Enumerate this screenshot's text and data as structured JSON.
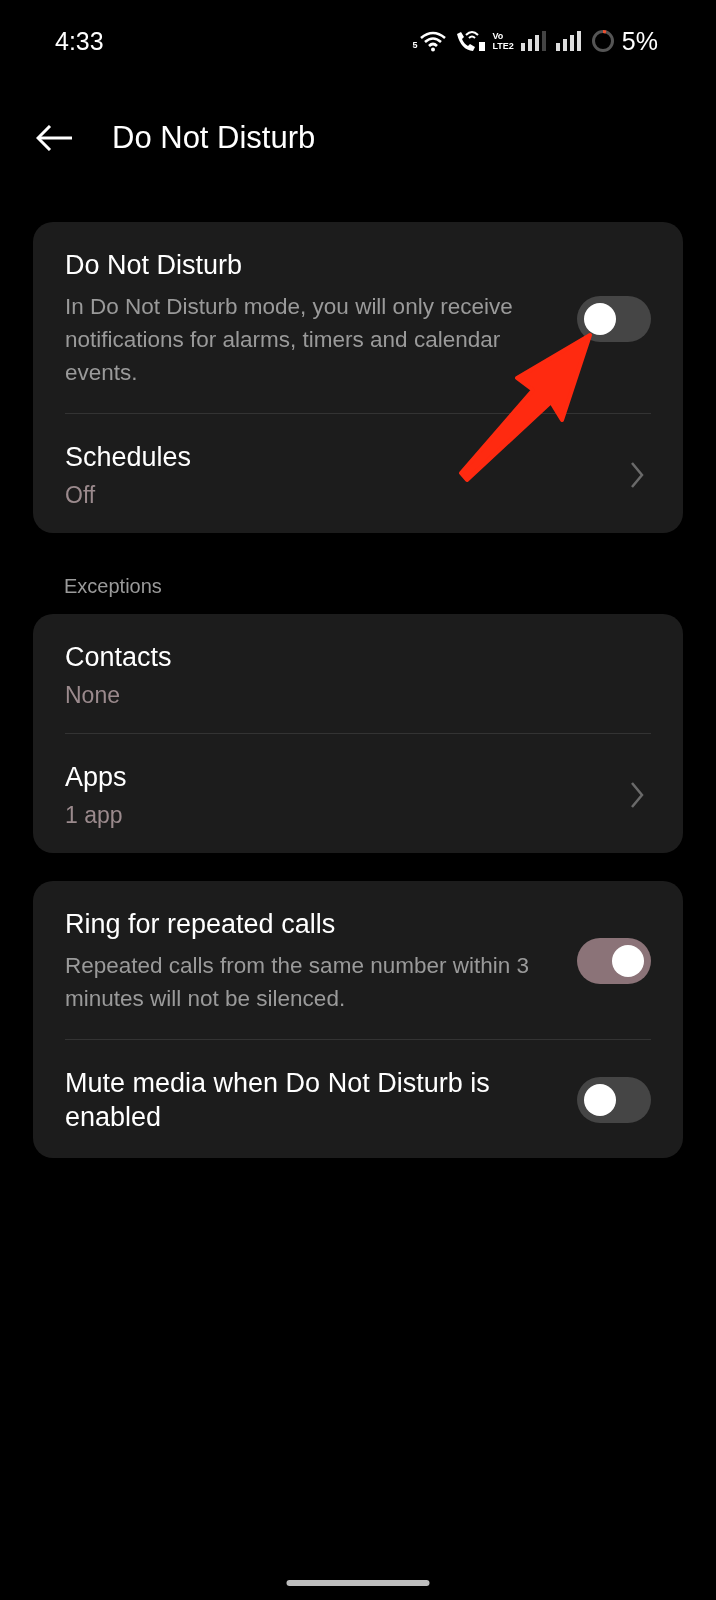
{
  "status_bar": {
    "time": "4:33",
    "wifi_badge": "5",
    "volte_top": "Vo",
    "volte_bottom": "LTE2",
    "battery": "5%"
  },
  "header": {
    "title": "Do Not Disturb"
  },
  "sections": [
    {
      "rows": [
        {
          "kind": "toggle",
          "title": "Do Not Disturb",
          "subtitle": "In Do Not Disturb mode, you will only receive notifications for alarms, timers and calendar events.",
          "on": false
        },
        {
          "kind": "link",
          "title": "Schedules",
          "value": "Off"
        }
      ]
    },
    {
      "label": "Exceptions",
      "rows": [
        {
          "kind": "info",
          "title": "Contacts",
          "value": "None"
        },
        {
          "kind": "link",
          "title": "Apps",
          "value": "1 app"
        }
      ]
    },
    {
      "rows": [
        {
          "kind": "toggle",
          "title": "Ring for repeated calls",
          "subtitle": "Repeated calls from the same number within 3 minutes will not be silenced.",
          "on": true
        },
        {
          "kind": "toggle",
          "title": "Mute media when Do Not Disturb is enabled",
          "on": false
        }
      ]
    }
  ]
}
